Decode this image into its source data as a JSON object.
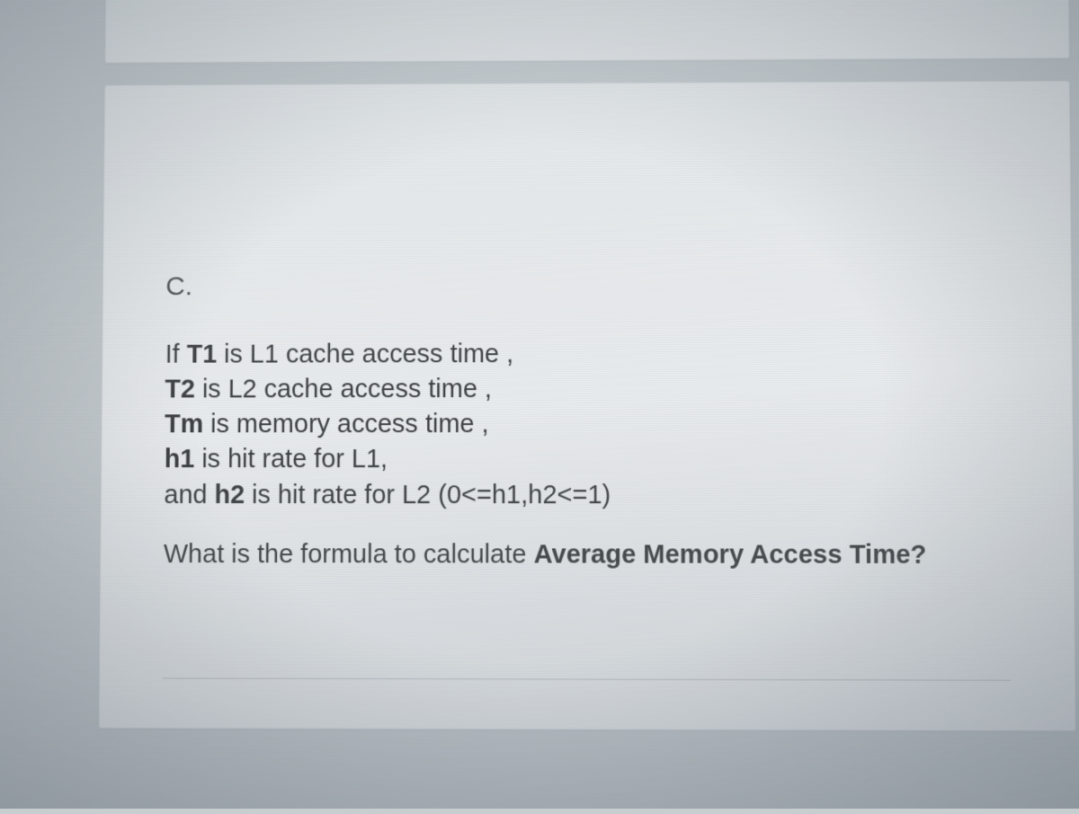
{
  "label": "C.",
  "lines": {
    "l1_pre": "If ",
    "l1_var": "T1",
    "l1_post": " is L1 cache access time ,",
    "l2_var": "T2",
    "l2_post": " is L2 cache access time ,",
    "l3_var": "Tm",
    "l3_post": " is memory access time ,",
    "l4_var": "h1",
    "l4_post": " is hit rate for L1,",
    "l5_pre": "and ",
    "l5_var": "h2",
    "l5_post": " is hit rate for L2  (0<=h1,h2<=1)"
  },
  "prompt": {
    "pre": "What is the formula to calculate ",
    "bold": "Average Memory Access Time?"
  }
}
